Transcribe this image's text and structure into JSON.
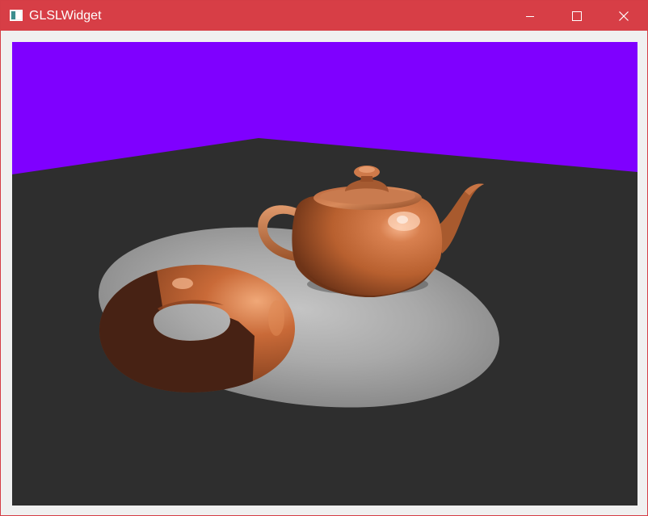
{
  "window": {
    "title": "GLSLWidget",
    "app_icon": "qt-window-icon"
  },
  "controls": {
    "minimize_icon": "minimize-icon",
    "maximize_icon": "maximize-icon",
    "close_icon": "close-icon"
  },
  "scene": {
    "background_color": "#7f00ff",
    "floor_color": "#2e2e2e",
    "spotlight_color": "#bdbdbd",
    "object_color": "#c8683c",
    "objects": [
      "teapot",
      "torus"
    ]
  }
}
